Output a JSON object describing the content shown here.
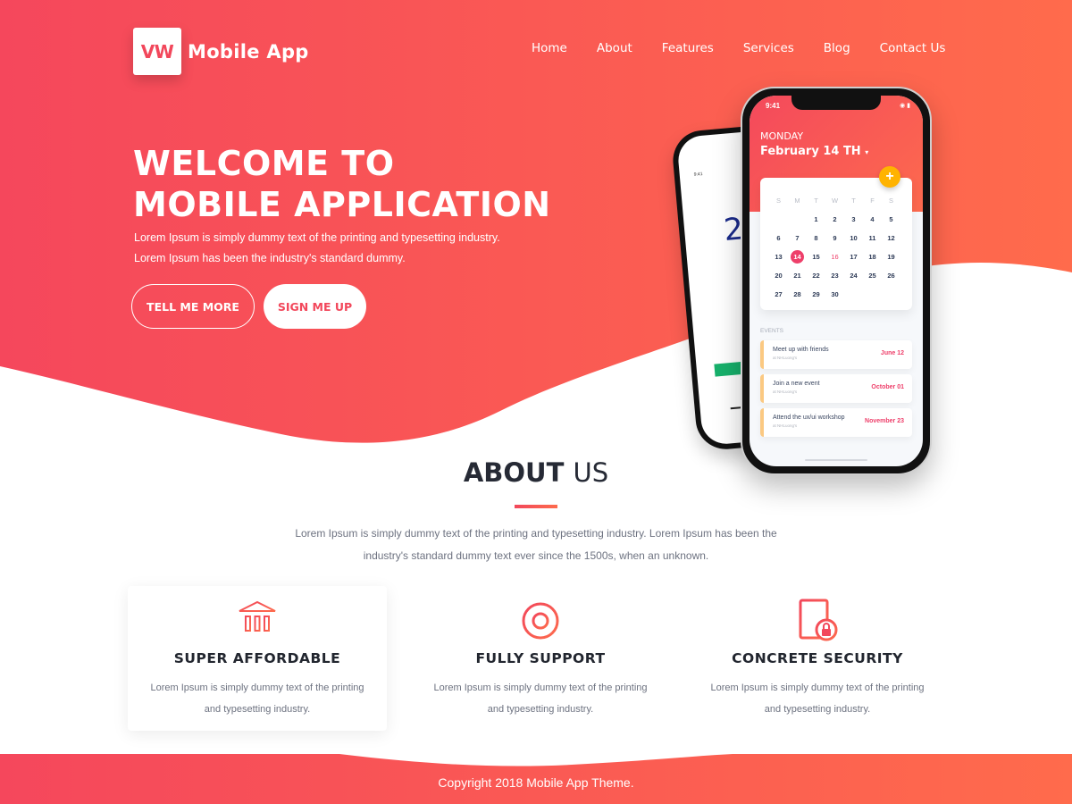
{
  "brand": {
    "logo_mark": "VW",
    "name": "Mobile App"
  },
  "nav": {
    "items": [
      {
        "label": "Home"
      },
      {
        "label": "About"
      },
      {
        "label": "Features"
      },
      {
        "label": "Services"
      },
      {
        "label": "Blog"
      },
      {
        "label": "Contact Us"
      }
    ]
  },
  "hero": {
    "title": "WELCOME TO MOBILE APPLICATION",
    "subtitle_line1": "Lorem Ipsum is simply dummy text of the printing and typesetting industry.",
    "subtitle_line2": "Lorem Ipsum has been the industry's standard dummy.",
    "primary_button": "TELL ME MORE",
    "secondary_button": "SIGN ME UP"
  },
  "phone": {
    "status_time": "9:41",
    "day": "MONDAY",
    "date": "February 14 TH",
    "add_icon": "plus-icon",
    "calendar": {
      "weekdays": [
        "S",
        "M",
        "T",
        "W",
        "T",
        "F",
        "S"
      ],
      "leading_blanks": 2,
      "days": 30,
      "selected": 14,
      "highlighted": 16
    },
    "events_label": "EVENTS",
    "events": [
      {
        "title": "Meet up with friends",
        "location": "at NHLuong's",
        "date": "June 12"
      },
      {
        "title": "Join a new event",
        "location": "at NHLuong's",
        "date": "October 01"
      },
      {
        "title": "Attend the ux/ui workshop",
        "location": "at NHLuong's",
        "date": "November 23"
      }
    ],
    "back_phone": {
      "time": "9:41",
      "temp": "2"
    }
  },
  "about": {
    "title_bold": "ABOUT",
    "title_light": "US",
    "text": "Lorem Ipsum is simply dummy text of the printing and typesetting industry. Lorem Ipsum has been the industry's standard dummy text ever since the 1500s, when an unknown."
  },
  "features": [
    {
      "icon": "bank-icon",
      "title": "SUPER AFFORDABLE",
      "text": "Lorem Ipsum is simply dummy text of the printing and typesetting industry."
    },
    {
      "icon": "lifebuoy-icon",
      "title": "FULLY SUPPORT",
      "text": "Lorem Ipsum is simply dummy text of the printing and typesetting industry."
    },
    {
      "icon": "secure-document-icon",
      "title": "CONCRETE SECURITY",
      "text": "Lorem Ipsum is simply dummy text of the printing and typesetting industry."
    }
  ],
  "footer": {
    "copyright": "Copyright 2018 Mobile App Theme."
  },
  "colors": {
    "gradient_start": "#f5475c",
    "gradient_end": "#ff6b4c",
    "text_dark": "#262a35",
    "text_muted": "#6d7280"
  }
}
